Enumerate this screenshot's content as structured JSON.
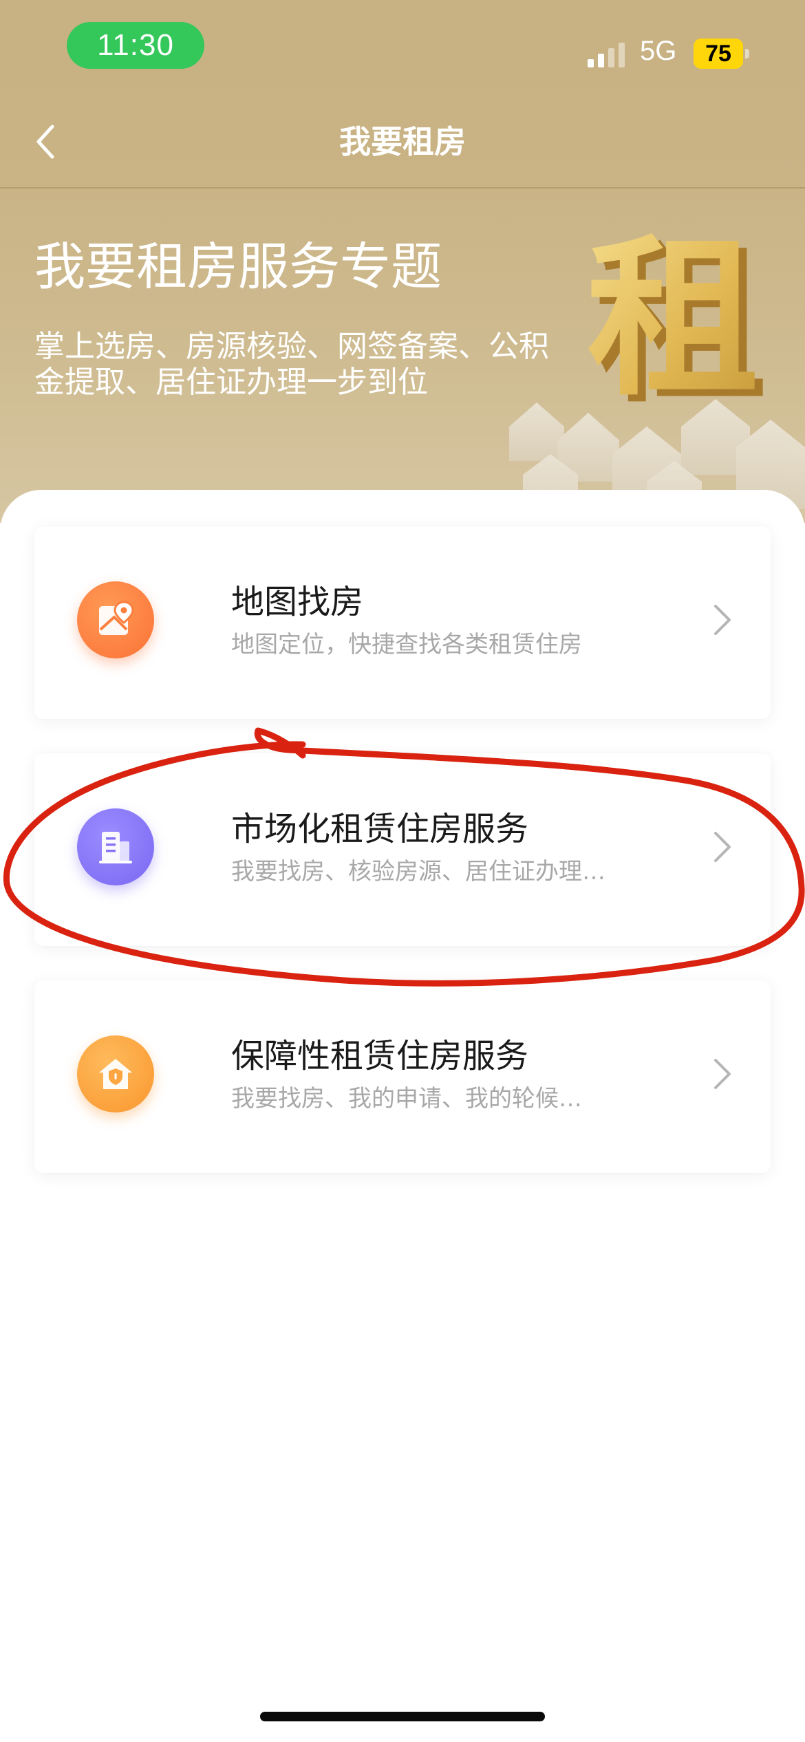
{
  "status_bar": {
    "time": "11:30",
    "network": "5G",
    "battery": "75"
  },
  "nav": {
    "title": "我要租房"
  },
  "banner": {
    "title": "我要租房服务专题",
    "subtitle": "掌上选房、房源核验、网签备案、公积金提取、居住证办理一步到位",
    "art_glyph": "租"
  },
  "cards": [
    {
      "title": "地图找房",
      "desc": "地图定位，快捷查找各类租赁住房",
      "icon": "map-location-icon",
      "color": "#fb7f3d"
    },
    {
      "title": "市场化租赁住房服务",
      "desc": "我要找房、核验房源、居住证办理…",
      "icon": "building-icon",
      "color": "#8674f7"
    },
    {
      "title": "保障性租赁住房服务",
      "desc": "我要找房、我的申请、我的轮候…",
      "icon": "house-shield-icon",
      "color": "#fba640"
    }
  ],
  "colors": {
    "header": "#c9b385",
    "highlight_annotation": "#d92310",
    "time_pill": "#34c759",
    "battery": "#ffd60a"
  }
}
